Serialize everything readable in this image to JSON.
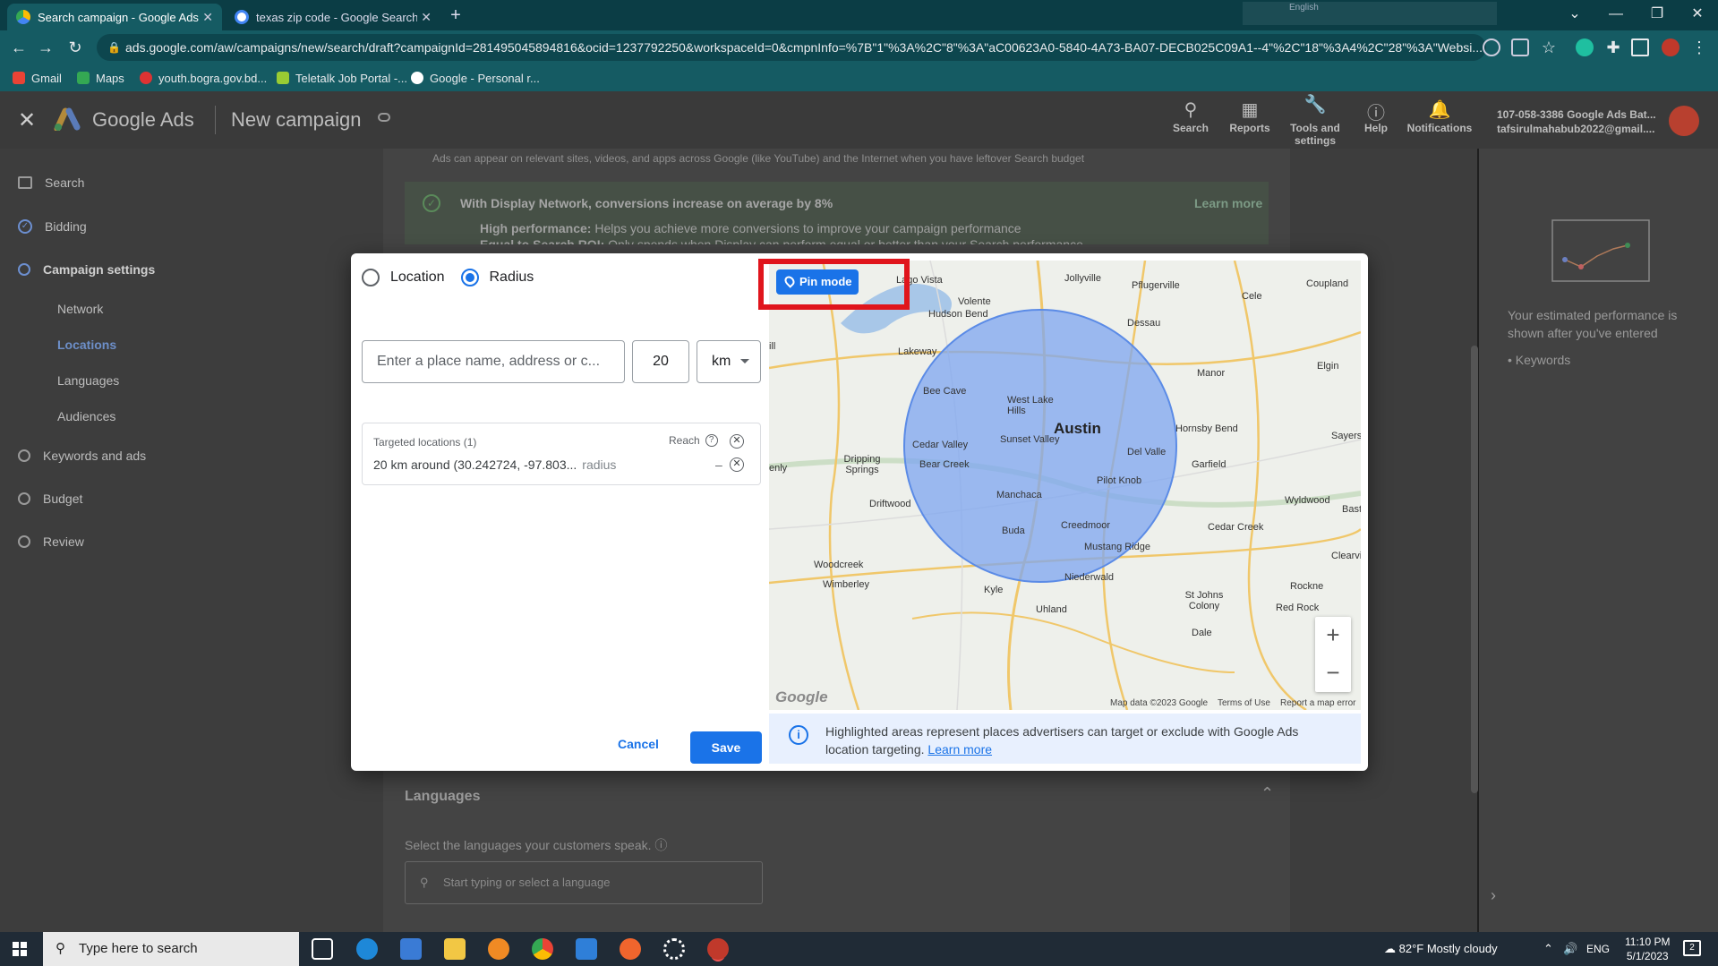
{
  "browser": {
    "tabs": [
      {
        "title": "Search campaign - Google Ads B",
        "active": true
      },
      {
        "title": "texas zip code - Google Search",
        "active": false
      }
    ],
    "url": "ads.google.com/aw/campaigns/new/search/draft?campaignId=281495045894816&ocid=1237792250&workspaceId=0&cmpnInfo=%7B\"1\"%3A%2C\"8\"%3A\"aC00623A0-5840-4A73-BA07-DECB025C09A1--4\"%2C\"18\"%3A4%2C\"28\"%3A\"Websi...",
    "bookmarks": [
      "Gmail",
      "Maps",
      "youth.bogra.gov.bd...",
      "Teletalk Job Portal -...",
      "Google - Personal r..."
    ],
    "lang_indicator": "English"
  },
  "app": {
    "product": "Google Ads",
    "page_title": "New campaign",
    "header_tools": [
      "Search",
      "Reports",
      "Tools and settings",
      "Help",
      "Notifications"
    ],
    "account_line1": "107-058-3386 Google Ads Bat...",
    "account_line2": "tafsirulmahabub2022@gmail...."
  },
  "sidebar": {
    "items": [
      {
        "label": "Search",
        "state": "plain"
      },
      {
        "label": "Bidding",
        "state": "done"
      },
      {
        "label": "Campaign settings",
        "state": "current"
      },
      {
        "label": "Network",
        "state": "sub"
      },
      {
        "label": "Locations",
        "state": "sub-selected"
      },
      {
        "label": "Languages",
        "state": "sub"
      },
      {
        "label": "Audiences",
        "state": "sub"
      },
      {
        "label": "Keywords and ads",
        "state": "todo"
      },
      {
        "label": "Budget",
        "state": "todo"
      },
      {
        "label": "Review",
        "state": "todo"
      }
    ]
  },
  "background": {
    "display_note": "Ads can appear on relevant sites, videos, and apps across Google (like YouTube) and the Internet when you have leftover Search budget",
    "banner_title": "With Display Network, conversions increase on average by 8%",
    "banner_learn": "Learn more",
    "bullet1_bold": "High performance:",
    "bullet1": " Helps you achieve more conversions to improve your campaign performance",
    "bullet2_bold": "Equal to Search ROI:",
    "bullet2": " Only spends when Display can perform equal or better than your Search performance",
    "languages_title": "Languages",
    "languages_help": "Select the languages your customers speak.",
    "languages_placeholder": "Start typing or select a language",
    "perf_text": "Your estimated performance is shown after you've entered",
    "perf_item": "Keywords"
  },
  "modal": {
    "option_location": "Location",
    "option_radius": "Radius",
    "selected_option": "Radius",
    "place_placeholder": "Enter a place name, address or c...",
    "radius_value": "20",
    "radius_unit": "km",
    "targeted_header": "Targeted locations (1)",
    "reach_label": "Reach",
    "target_row": "20 km around (30.242724, -97.803...",
    "target_row_type": "radius",
    "reach_value": "–",
    "pin_mode_label": "Pin mode",
    "cancel_label": "Cancel",
    "save_label": "Save",
    "info_text": "Highlighted areas represent places advertisers can target or exclude with Google Ads location targeting.",
    "info_link": "Learn more",
    "map_footer": [
      "Map data ©2023 Google",
      "Terms of Use",
      "Report a map error"
    ],
    "map_logo": "Google",
    "map_labels": [
      "Lago Vista",
      "Jollyville",
      "Pflugerville",
      "Cele",
      "Coupland",
      "Volente",
      "Hudson Bend",
      "Dessau",
      "Lakeway",
      "Elgin",
      "Manor",
      "West Lake Hills",
      "Bee Cave",
      "Austin",
      "Hornsby Bend",
      "Sayersv",
      "Cedar Valley",
      "Sunset Valley",
      "Del Valle",
      "Dripping Springs",
      "Bear Creek",
      "Garfield",
      "Pilot Knob",
      "Driftwood",
      "Manchaca",
      "Wyldwood",
      "Bast",
      "Buda",
      "Creedmoor",
      "Cedar Creek",
      "Mustang Ridge",
      "Clearvie",
      "Woodcreek",
      "Niederwald",
      "Wimberley",
      "Kyle",
      "Rockne",
      "St Johns Colony",
      "Red Rock",
      "Uhland",
      "Dale",
      "enly",
      "ill"
    ]
  },
  "taskbar": {
    "search_placeholder": "Type here to search",
    "weather": "82°F  Mostly cloudy",
    "lang": "ENG",
    "time": "11:10 PM",
    "date": "5/1/2023",
    "notif_count": "2"
  },
  "colors": {
    "accent": "#1a73e8",
    "highlight_box": "#e0151c",
    "radius_fill": "#7ea6f0"
  }
}
